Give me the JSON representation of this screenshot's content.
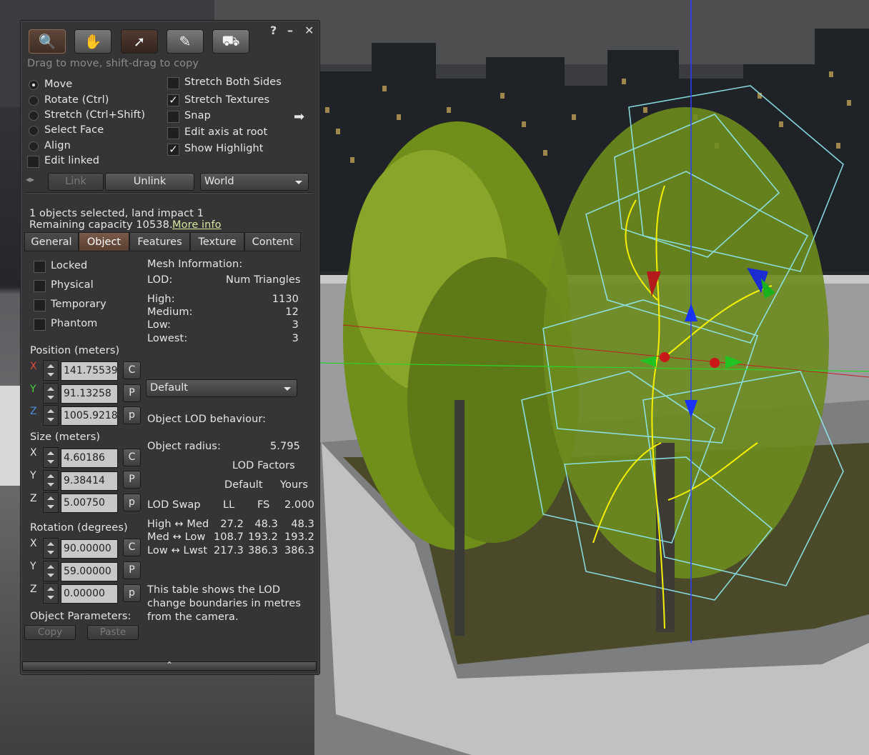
{
  "toolbar": {
    "tools": [
      "focus-tool-icon",
      "grab-tool-icon",
      "edit-tool-icon",
      "create-tool-icon",
      "land-tool-icon"
    ],
    "help": "?",
    "minimize": "–",
    "close": "✕"
  },
  "hint": "Drag to move, shift-drag to copy",
  "edit_modes": {
    "move": "Move",
    "rotate": "Rotate (Ctrl)",
    "stretch": "Stretch (Ctrl+Shift)",
    "select_face": "Select Face",
    "align": "Align",
    "edit_linked": "Edit linked",
    "selected": "Move"
  },
  "options": {
    "stretch_both_sides": {
      "label": "Stretch Both Sides",
      "checked": false
    },
    "stretch_textures": {
      "label": "Stretch Textures",
      "checked": true
    },
    "snap": {
      "label": "Snap",
      "checked": false
    },
    "edit_axis_root": {
      "label": "Edit axis at root",
      "checked": false
    },
    "show_highlight": {
      "label": "Show Highlight",
      "checked": true
    }
  },
  "link_bar": {
    "link": "Link",
    "unlink": "Unlink",
    "grid": "World"
  },
  "selection": {
    "line1": "1 objects selected, land impact 1",
    "line2": "Remaining capacity 10538.",
    "more_info": "More info"
  },
  "tabs": [
    "General",
    "Object",
    "Features",
    "Texture",
    "Content"
  ],
  "active_tab": "Object",
  "object": {
    "locked": "Locked",
    "physical": "Physical",
    "temporary": "Temporary",
    "phantom": "Phantom",
    "position_label": "Position (meters)",
    "position": {
      "x": "141.75539",
      "y": "91.13258",
      "z": "1005.9218"
    },
    "size_label": "Size (meters)",
    "size": {
      "x": "4.60186",
      "y": "9.38414",
      "z": "5.00750"
    },
    "rotation_label": "Rotation (degrees)",
    "rotation": {
      "x": "90.00000",
      "y": "59.00000",
      "z": "0.00000"
    },
    "axis_labels": {
      "x": "X",
      "y": "Y",
      "z": "Z"
    },
    "button_c": "C",
    "button_p_upper": "P",
    "button_p_lower": "p",
    "params_label": "Object Parameters:",
    "copy": "Copy",
    "paste": "Paste"
  },
  "mesh": {
    "title": "Mesh Information:",
    "lod_header": "LOD:",
    "num_tri_header": "Num Triangles",
    "rows": [
      {
        "label": "High:",
        "value": "1130"
      },
      {
        "label": "Medium:",
        "value": "12"
      },
      {
        "label": "Low:",
        "value": "3"
      },
      {
        "label": "Lowest:",
        "value": "3"
      }
    ],
    "lod_preset": "Default",
    "lod_behaviour": "Object LOD behaviour:",
    "radius_label": "Object radius:",
    "radius_value": "5.795",
    "lod_factors": "LOD Factors",
    "col_default": "Default",
    "col_yours": "Yours",
    "swap_header": {
      "label": "LOD Swap",
      "ll": "LL",
      "fs": "FS",
      "yours": "2.000"
    },
    "swap_rows": [
      {
        "label": "High ↔ Med",
        "ll": "27.2",
        "fs": "48.3",
        "yours": "48.3"
      },
      {
        "label": "Med ↔ Low",
        "ll": "108.7",
        "fs": "193.2",
        "yours": "193.2"
      },
      {
        "label": "Low ↔ Lwst",
        "ll": "217.3",
        "fs": "386.3",
        "yours": "386.3"
      }
    ],
    "note": [
      "This table shows the LOD",
      "change boundaries in metres",
      "from the camera."
    ]
  },
  "colors": {
    "accent_tab": "#6a4d3f",
    "link": "#d6e7a0",
    "axis_x": "#e04a3a",
    "axis_y": "#4ccf3c",
    "axis_z": "#4a8ee0"
  }
}
